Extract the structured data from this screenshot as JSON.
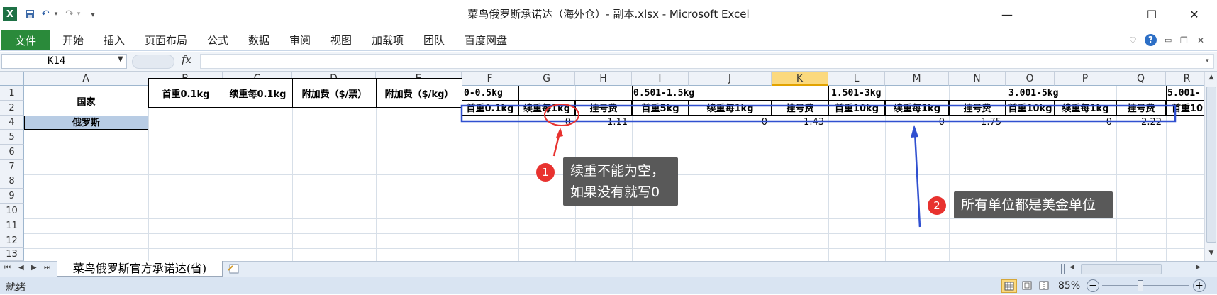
{
  "title_bar": {
    "title": "菜鸟俄罗斯承诺达（海外仓）- 副本.xlsx - Microsoft Excel",
    "excel_logo": "X",
    "save_icon": "save-icon",
    "undo_icon": "↶",
    "redo_icon": "↷",
    "customize_icon": "▾",
    "minimize": "—",
    "maximize": "☐",
    "close": "✕"
  },
  "ribbon": {
    "file": "文件",
    "tabs": [
      "开始",
      "插入",
      "页面布局",
      "公式",
      "数据",
      "审阅",
      "视图",
      "加载项",
      "团队",
      "百度网盘"
    ],
    "right_icons": {
      "collapse": "♡",
      "help": "?",
      "min": "▭",
      "restore": "❐",
      "close": "✕"
    }
  },
  "formula_bar": {
    "name_box": "K14",
    "fx": "fx",
    "formula": ""
  },
  "grid": {
    "columns": [
      "A",
      "B",
      "C",
      "D",
      "E",
      "F",
      "G",
      "H",
      "I",
      "J",
      "K",
      "L",
      "M",
      "N",
      "O",
      "P",
      "Q",
      "R"
    ],
    "selected_column": "K",
    "rows": [
      "1",
      "2",
      "4",
      "5",
      "6",
      "7",
      "8",
      "9",
      "10",
      "11",
      "12",
      "13"
    ],
    "merged_headers": {
      "country": "国家",
      "first_weight": "首重0.1kg",
      "continued_weight": "续重每0.1kg",
      "surcharge_ticket": "附加费（$/票）",
      "surcharge_kg": "附加费（$/kg）"
    },
    "bands": {
      "band1": "0-0.5kg",
      "band2": "0.501-1.5kg",
      "band3": "1.501-3kg",
      "band4": "3.001-5kg",
      "band5": "5.001-"
    },
    "row2_headers": [
      "首重0.1kg",
      "续重每1kg",
      "挂号费",
      "首重5kg",
      "续重每1kg",
      "挂号费",
      "首重10kg",
      "续重每1kg",
      "挂号费",
      "首重10kg",
      "续重每1kg",
      "挂号费",
      "首重10"
    ],
    "row4": {
      "country": "俄罗斯",
      "G": "0",
      "H": "1.11",
      "J": "0",
      "K": "1.43",
      "M": "0",
      "N": "1.75",
      "P": "0",
      "Q": "2.22"
    }
  },
  "annotations": {
    "badge1": "1",
    "callout1_line1": "续重不能为空，",
    "callout1_line2": "如果没有就写0",
    "badge2": "2",
    "callout2": "所有单位都是美金单位",
    "colors": {
      "box": "#3050d0",
      "circle": "#e8322f",
      "arrow1": "#e8322f",
      "arrow2": "#3050d0"
    }
  },
  "sheet_tabs": {
    "nav": [
      "⏮",
      "◀",
      "▶",
      "⏭"
    ],
    "active_sheet": "菜鸟俄罗斯官方承诺达(省)",
    "new_sheet_icon": "new-sheet-icon"
  },
  "status_bar": {
    "ready": "就绪",
    "zoom": "85%",
    "zoom_out": "−",
    "zoom_in": "+"
  }
}
